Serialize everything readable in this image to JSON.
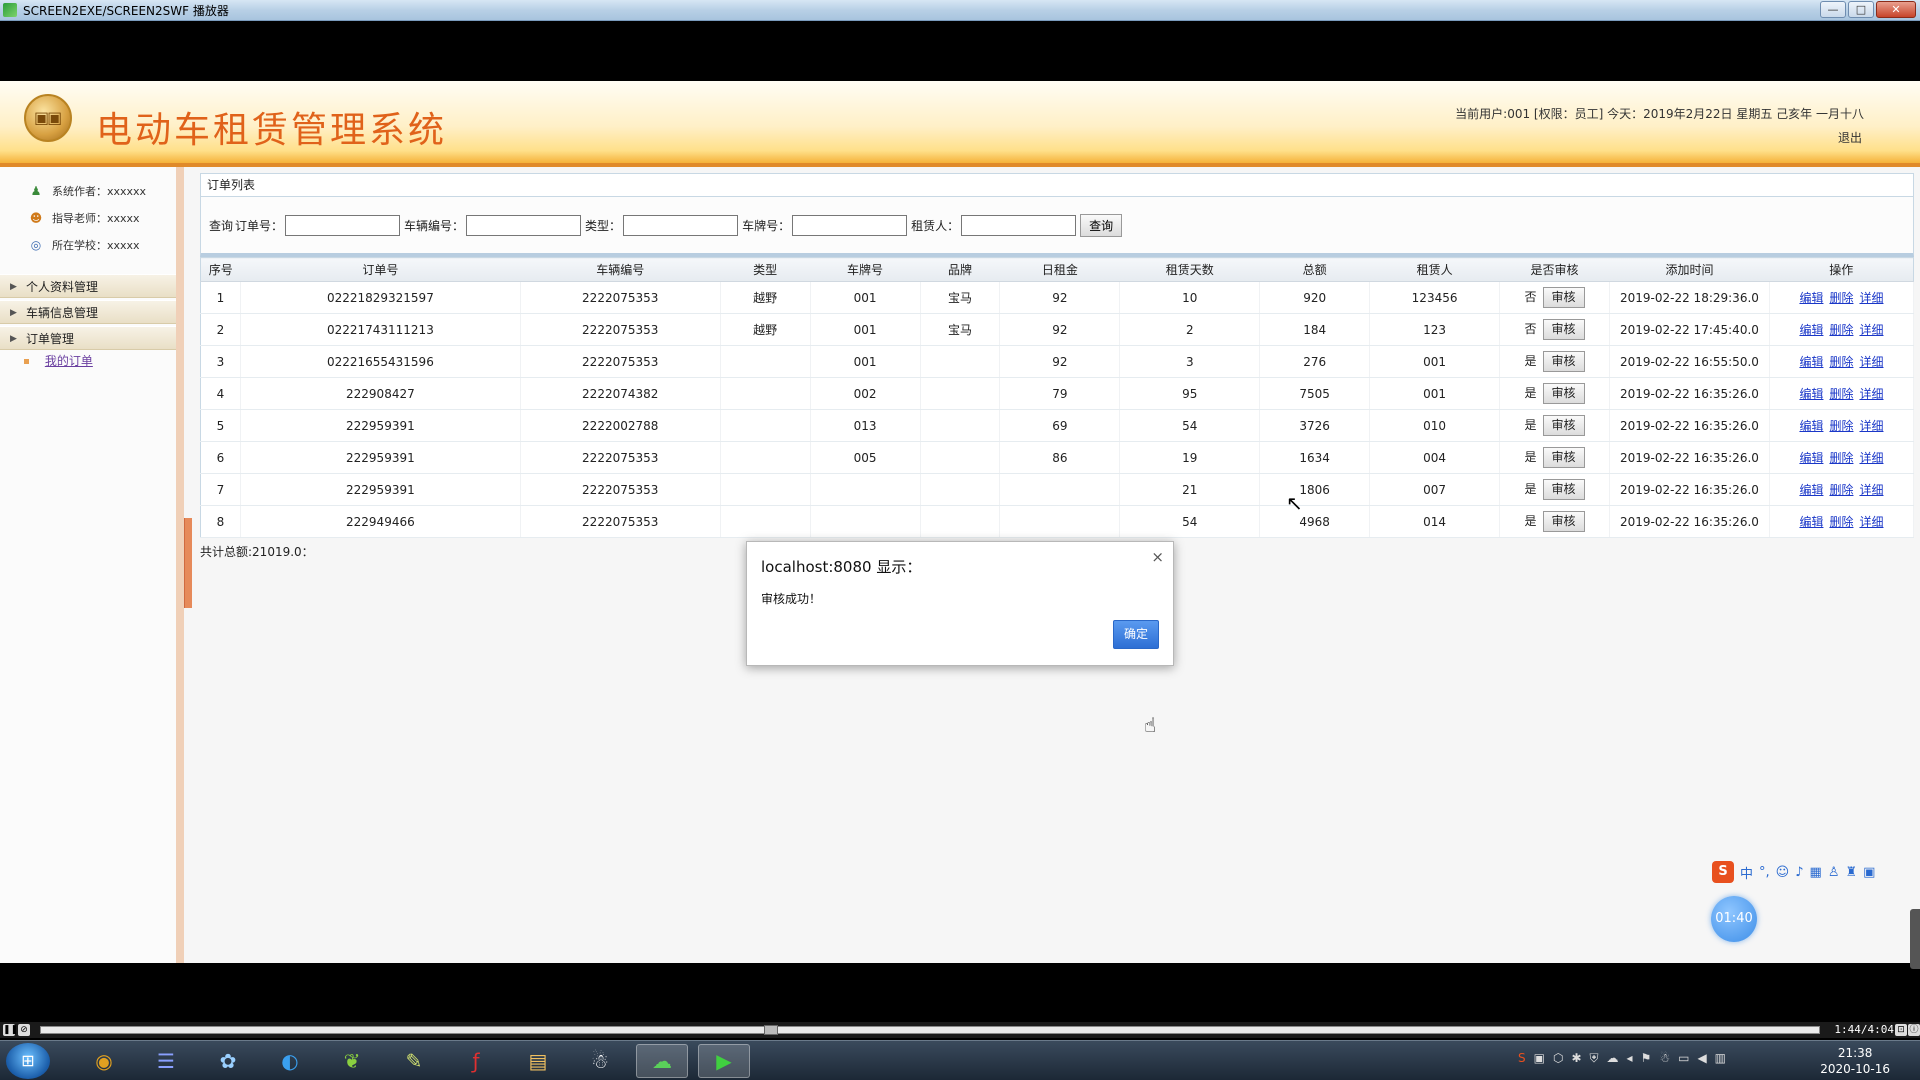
{
  "window": {
    "title": "SCREEN2EXE/SCREEN2SWF 播放器",
    "min_glyph": "—",
    "max_glyph": "□",
    "close_glyph": "✕"
  },
  "header": {
    "system_title": "电动车租赁管理系统",
    "user_info": "当前用户:001 [权限：员工] 今天：2019年2月22日 星期五 己亥年 一月十八",
    "logout": "退出"
  },
  "sidebar": {
    "info": [
      {
        "icon": "author-icon",
        "text": "系统作者：xxxxxx"
      },
      {
        "icon": "teacher-icon",
        "text": "指导老师：xxxxx"
      },
      {
        "icon": "school-icon",
        "text": "所在学校：xxxxx"
      }
    ],
    "menus": [
      {
        "label": "个人资料管理"
      },
      {
        "label": "车辆信息管理"
      },
      {
        "label": "订单管理"
      }
    ],
    "sub_item": "我的订单"
  },
  "panel": {
    "title": "订单列表"
  },
  "search": {
    "prefix": "查询",
    "order_no_label": "订单号：",
    "vehicle_no_label": "车辆编号：",
    "type_label": "类型：",
    "plate_label": "车牌号：",
    "renter_label": "租赁人：",
    "order_no_value": "",
    "vehicle_no_value": "",
    "type_value": "",
    "plate_value": "",
    "renter_value": "",
    "query_button": "查询"
  },
  "table": {
    "headers": [
      "序号",
      "订单号",
      "车辆编号",
      "类型",
      "车牌号",
      "品牌",
      "日租金",
      "租赁天数",
      "总额",
      "租赁人",
      "是否审核",
      "添加时间",
      "操作"
    ],
    "audit_button": "审核",
    "actions": [
      "编辑",
      "删除",
      "详细"
    ],
    "rows": [
      {
        "idx": "1",
        "order_no": "02221829321597",
        "vehicle_no": "2222075353",
        "type": "越野",
        "plate": "001",
        "brand": "宝马",
        "daily": "92",
        "days": "10",
        "total": "920",
        "renter": "123456",
        "audited": "否",
        "time": "2019-02-22 18:29:36.0"
      },
      {
        "idx": "2",
        "order_no": "02221743111213",
        "vehicle_no": "2222075353",
        "type": "越野",
        "plate": "001",
        "brand": "宝马",
        "daily": "92",
        "days": "2",
        "total": "184",
        "renter": "123",
        "audited": "否",
        "time": "2019-02-22 17:45:40.0"
      },
      {
        "idx": "3",
        "order_no": "02221655431596",
        "vehicle_no": "2222075353",
        "type": "",
        "plate": "001",
        "brand": "",
        "daily": "92",
        "days": "3",
        "total": "276",
        "renter": "001",
        "audited": "是",
        "time": "2019-02-22 16:55:50.0"
      },
      {
        "idx": "4",
        "order_no": "222908427",
        "vehicle_no": "2222074382",
        "type": "",
        "plate": "002",
        "brand": "",
        "daily": "79",
        "days": "95",
        "total": "7505",
        "renter": "001",
        "audited": "是",
        "time": "2019-02-22 16:35:26.0"
      },
      {
        "idx": "5",
        "order_no": "222959391",
        "vehicle_no": "2222002788",
        "type": "",
        "plate": "013",
        "brand": "",
        "daily": "69",
        "days": "54",
        "total": "3726",
        "renter": "010",
        "audited": "是",
        "time": "2019-02-22 16:35:26.0"
      },
      {
        "idx": "6",
        "order_no": "222959391",
        "vehicle_no": "2222075353",
        "type": "",
        "plate": "005",
        "brand": "",
        "daily": "86",
        "days": "19",
        "total": "1634",
        "renter": "004",
        "audited": "是",
        "time": "2019-02-22 16:35:26.0"
      },
      {
        "idx": "7",
        "order_no": "222959391",
        "vehicle_no": "2222075353",
        "type": "",
        "plate": "",
        "brand": "",
        "daily": "",
        "days": "21",
        "total": "1806",
        "renter": "007",
        "audited": "是",
        "time": "2019-02-22 16:35:26.0"
      },
      {
        "idx": "8",
        "order_no": "222949466",
        "vehicle_no": "2222075353",
        "type": "",
        "plate": "",
        "brand": "",
        "daily": "",
        "days": "54",
        "total": "4968",
        "renter": "014",
        "audited": "是",
        "time": "2019-02-22 16:35:26.0"
      }
    ],
    "total_text": "共计总额:21019.0："
  },
  "dialog": {
    "title": "localhost:8080 显示：",
    "message": "审核成功！",
    "ok": "确定",
    "close_glyph": "×"
  },
  "overlay": {
    "timer": "01:40",
    "ime_s": "S",
    "ime_mode": "中"
  },
  "player": {
    "time": "1:44/4:04",
    "progress": 0.41
  },
  "taskbar": {
    "clock_time": "21:38",
    "clock_date": "2020-10-16"
  }
}
